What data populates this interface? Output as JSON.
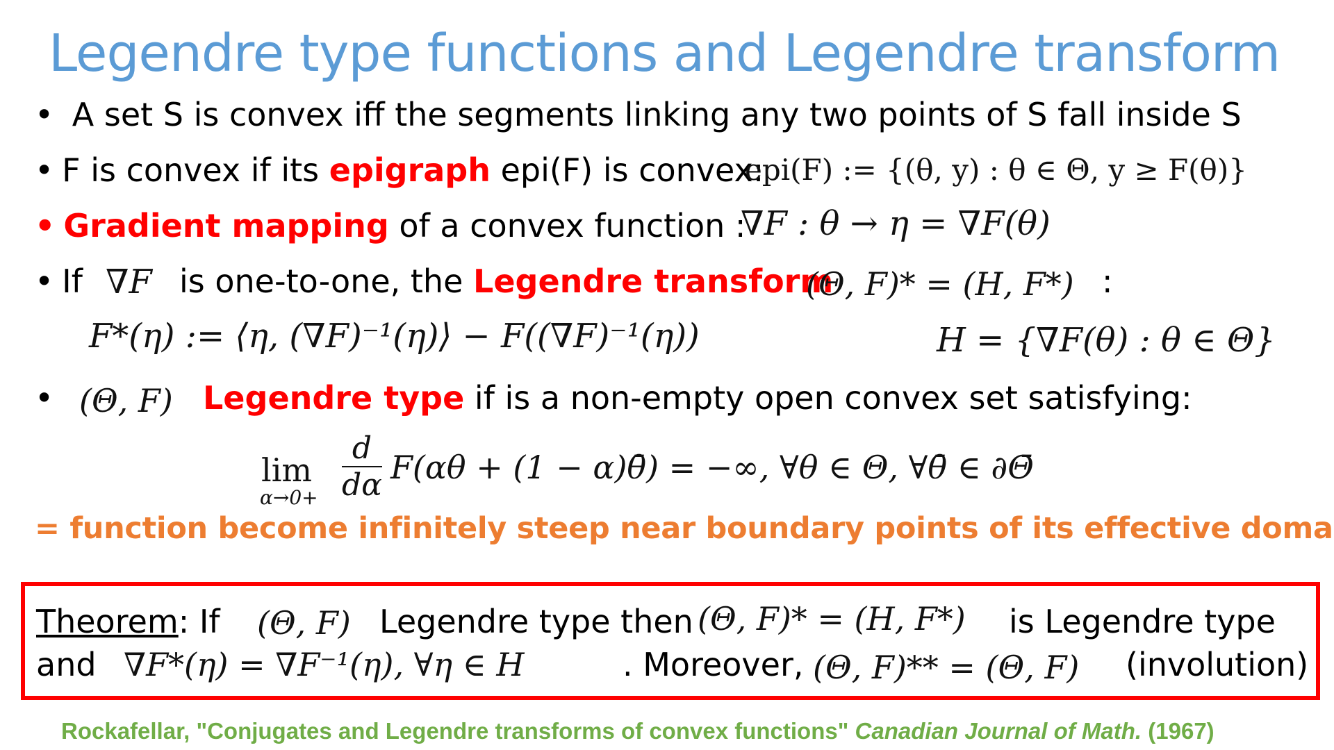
{
  "title": "Legendre type functions and Legendre transform",
  "bullets": {
    "b1": {
      "marker": "•",
      "text": "A set S is convex iff the segments linking any two points of S fall inside S"
    },
    "b2": {
      "marker": "•",
      "text_a": "F is convex if its ",
      "highlight": "epigraph",
      "text_b": " epi(F) is convex:",
      "math": "epi(F) := {(θ, y)   :   θ ∈ Θ, y ≥ F(θ)}"
    },
    "b3": {
      "marker": "•",
      "highlight": "Gradient mapping",
      "text": " of a convex function :",
      "math": "∇F : θ → η = ∇F(θ)"
    },
    "b4": {
      "marker": "•",
      "text_a": "If",
      "math_a": "∇F",
      "text_b": "is one-to-one, the ",
      "highlight": "Legendre transform",
      "math_b": "(Θ, F)* = (H, F*)",
      "text_c": ":",
      "math_c": "F*(η) := ⟨η, (∇F)⁻¹(η)⟩ − F((∇F)⁻¹(η))",
      "math_d": "H = {∇F(θ)  :  θ ∈ Θ}"
    },
    "b5": {
      "marker": "•",
      "math_a": "(Θ, F)",
      "highlight": "Legendre type",
      "text": " if  is a non-empty open convex set satisfying:",
      "lim": "lim",
      "lim_sub": "α→0+",
      "frac_num": "d",
      "frac_den": "dα",
      "math_tail": "F(αθ + (1 − α)θ̄) = −∞, ∀θ ∈ Θ, ∀θ̄ ∈ ∂Θ̄"
    }
  },
  "note": "= function become infinitely steep near boundary points of its effective domain",
  "theorem": {
    "label": "Theorem",
    "colon_if": ": If",
    "math_a": "(Θ, F)",
    "text_a": "Legendre type then",
    "math_b": "(Θ, F)* = (H, F*)",
    "text_b": "is Legendre type",
    "text_and": "and",
    "math_c": "∇F*(η) = ∇F⁻¹(η), ∀η ∈ H",
    "text_c": ". Moreover,",
    "math_d": "(Θ, F)** = (Θ, F)",
    "text_d": "(involution)"
  },
  "citation": {
    "author_title": "Rockafellar, \"Conjugates and Legendre transforms of convex functions\"",
    "journal": "Canadian Journal of Math.",
    "year": "(1967)"
  },
  "colors": {
    "title": "#5B9BD5",
    "highlight_red": "#FF0000",
    "highlight_orange": "#ED7D31",
    "citation": "#70AD47",
    "box_border": "#FF0000"
  }
}
